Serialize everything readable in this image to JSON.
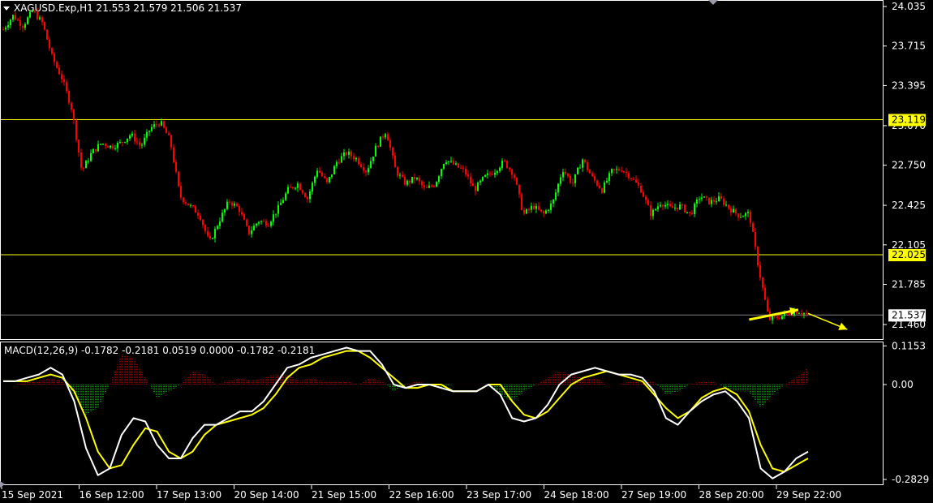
{
  "header": {
    "symbol_line": "XAGUSD.Exp,H1  21.553 21.579 21.506 21.537"
  },
  "colors": {
    "background": "#000000",
    "bull_candle": "#00ff00",
    "bear_candle": "#ff0000",
    "level_line": "#ffff00",
    "macd_line": "#ffffff",
    "signal_line": "#ffff00",
    "hist_positive": "#ff0000",
    "hist_negative": "#00ff00",
    "arrow": "#ffff00",
    "price_line": "#808080"
  },
  "chart_data": [
    {
      "type": "candlestick",
      "title": "XAGUSD.Exp,H1",
      "ohlc_last": {
        "open": 21.553,
        "high": 21.579,
        "low": 21.506,
        "close": 21.537
      },
      "y_ticks": [
        "24.035",
        "23.715",
        "23.395",
        "23.070",
        "22.750",
        "22.425",
        "22.105",
        "21.785",
        "21.460"
      ],
      "ylim": [
        21.415,
        24.075
      ],
      "horizontal_levels": [
        {
          "label": "23.119",
          "value": 23.119
        },
        {
          "label": "22.025",
          "value": 22.025
        }
      ],
      "current_price": {
        "label": "21.537",
        "value": 21.537
      },
      "x_labels": [
        "15 Sep 2021",
        "16 Sep 12:00",
        "17 Sep 13:00",
        "20 Sep 14:00",
        "21 Sep 15:00",
        "22 Sep 16:00",
        "23 Sep 17:00",
        "24 Sep 18:00",
        "27 Sep 19:00",
        "28 Sep 20:00",
        "29 Sep 22:00"
      ],
      "close_path": [
        23.85,
        23.96,
        23.88,
        24.0,
        23.9,
        23.62,
        23.45,
        23.2,
        22.7,
        22.85,
        22.93,
        22.9,
        22.93,
        23.0,
        22.9,
        23.05,
        23.1,
        22.95,
        22.5,
        22.42,
        22.35,
        22.12,
        22.3,
        22.46,
        22.4,
        22.2,
        22.3,
        22.28,
        22.4,
        22.55,
        22.6,
        22.48,
        22.72,
        22.6,
        22.78,
        22.85,
        22.8,
        22.7,
        22.9,
        23.03,
        22.7,
        22.6,
        22.65,
        22.55,
        22.6,
        22.8,
        22.75,
        22.7,
        22.55,
        22.65,
        22.7,
        22.78,
        22.68,
        22.35,
        22.42,
        22.35,
        22.45,
        22.72,
        22.6,
        22.8,
        22.65,
        22.55,
        22.7,
        22.72,
        22.65,
        22.55,
        22.35,
        22.45,
        22.4,
        22.42,
        22.35,
        22.5,
        22.45,
        22.48,
        22.4,
        22.34,
        22.36,
        21.9,
        21.5,
        21.52,
        21.55,
        21.57,
        21.537
      ],
      "annotations": [
        {
          "type": "trend_arrow",
          "from": {
            "x_index": 76,
            "y": 21.5
          },
          "to": {
            "x_index": 81,
            "y": 21.58
          }
        },
        {
          "type": "projection_arrow",
          "from": {
            "x_index": 82,
            "y": 21.55
          },
          "to": {
            "x_index": 86,
            "y": 21.42
          }
        }
      ]
    },
    {
      "type": "macd",
      "title": "MACD(12,26,9) -0.1782 -0.2181 0.0519 0.0000 -0.1782 -0.2181",
      "params": [
        12,
        26,
        9
      ],
      "y_ticks": [
        "0.1153",
        "0.00",
        "-0.2829"
      ],
      "ylim": [
        -0.31,
        0.13
      ],
      "macd_path": [
        0.01,
        0.01,
        0.02,
        0.03,
        0.05,
        0.03,
        -0.05,
        -0.19,
        -0.27,
        -0.25,
        -0.15,
        -0.1,
        -0.11,
        -0.18,
        -0.22,
        -0.22,
        -0.16,
        -0.12,
        -0.12,
        -0.1,
        -0.08,
        -0.08,
        -0.05,
        0.0,
        0.05,
        0.06,
        0.08,
        0.09,
        0.1,
        0.11,
        0.1,
        0.1,
        0.06,
        0.0,
        -0.01,
        0.0,
        0.0,
        -0.01,
        -0.02,
        -0.02,
        -0.02,
        0.0,
        -0.03,
        -0.1,
        -0.11,
        -0.1,
        -0.06,
        0.0,
        0.03,
        0.04,
        0.05,
        0.04,
        0.03,
        0.03,
        0.02,
        -0.02,
        -0.1,
        -0.12,
        -0.08,
        -0.05,
        -0.03,
        -0.02,
        -0.05,
        -0.1,
        -0.25,
        -0.28,
        -0.26,
        -0.22,
        -0.2
      ],
      "signal_path": [
        0.01,
        0.01,
        0.01,
        0.02,
        0.03,
        0.02,
        -0.02,
        -0.1,
        -0.2,
        -0.25,
        -0.24,
        -0.18,
        -0.13,
        -0.14,
        -0.2,
        -0.22,
        -0.2,
        -0.15,
        -0.12,
        -0.11,
        -0.1,
        -0.09,
        -0.07,
        -0.03,
        0.02,
        0.05,
        0.06,
        0.08,
        0.09,
        0.1,
        0.1,
        0.08,
        0.05,
        0.02,
        -0.01,
        -0.01,
        0.0,
        0.0,
        -0.02,
        -0.02,
        -0.02,
        0.0,
        0.0,
        -0.05,
        -0.09,
        -0.1,
        -0.08,
        -0.04,
        0.0,
        0.02,
        0.03,
        0.04,
        0.03,
        0.02,
        0.01,
        -0.03,
        -0.07,
        -0.1,
        -0.08,
        -0.04,
        -0.02,
        -0.01,
        -0.03,
        -0.08,
        -0.18,
        -0.25,
        -0.26,
        -0.24,
        -0.22
      ],
      "histogram_path": [
        0.0,
        0.0,
        0.01,
        0.01,
        0.02,
        0.01,
        -0.03,
        -0.09,
        -0.07,
        0.0,
        0.09,
        0.08,
        0.02,
        -0.04,
        -0.02,
        0.0,
        0.04,
        0.03,
        0.0,
        0.01,
        0.02,
        0.01,
        0.02,
        0.03,
        0.03,
        0.01,
        0.02,
        0.01,
        0.01,
        0.01,
        0.0,
        0.02,
        0.01,
        -0.02,
        0.0,
        0.01,
        0.0,
        -0.01,
        0.0,
        0.0,
        0.0,
        0.0,
        -0.03,
        -0.05,
        -0.02,
        0.0,
        0.02,
        0.04,
        0.03,
        0.02,
        0.02,
        0.0,
        0.0,
        0.01,
        0.01,
        0.01,
        -0.03,
        -0.02,
        0.0,
        0.01,
        0.01,
        -0.01,
        -0.02,
        -0.02,
        -0.07,
        -0.03,
        0.0,
        0.02,
        0.05
      ]
    }
  ]
}
